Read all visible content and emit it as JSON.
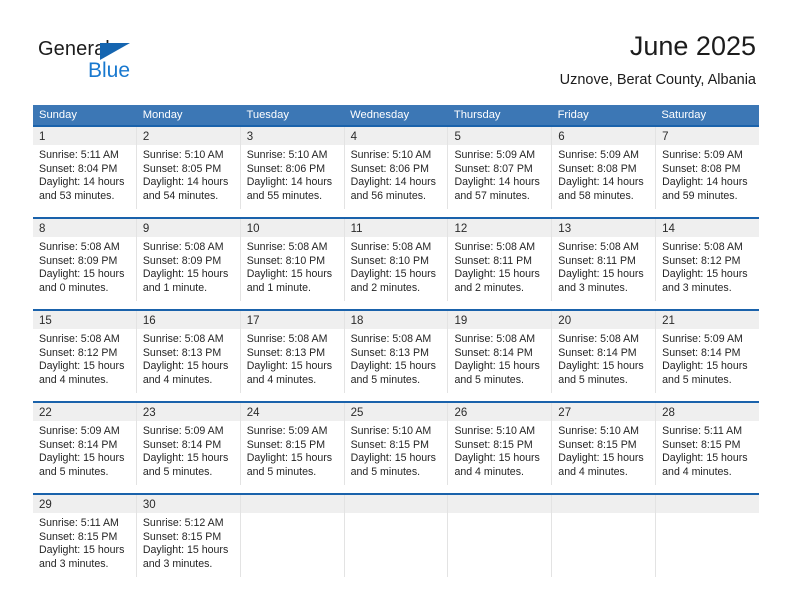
{
  "brand": {
    "name_part1": "General",
    "name_part2": "Blue",
    "accent_color": "#1878cf",
    "triangle_color": "#1565b0"
  },
  "header": {
    "title": "June 2025",
    "subtitle": "Uznove, Berat County, Albania"
  },
  "theme": {
    "header_bg": "#3c77b5",
    "week_border": "#1a62ab",
    "daynum_band": "#efefef"
  },
  "weekdays": [
    "Sunday",
    "Monday",
    "Tuesday",
    "Wednesday",
    "Thursday",
    "Friday",
    "Saturday"
  ],
  "weeks": [
    [
      {
        "day": "1",
        "sunrise": "Sunrise: 5:11 AM",
        "sunset": "Sunset: 8:04 PM",
        "daylight1": "Daylight: 14 hours",
        "daylight2": "and 53 minutes."
      },
      {
        "day": "2",
        "sunrise": "Sunrise: 5:10 AM",
        "sunset": "Sunset: 8:05 PM",
        "daylight1": "Daylight: 14 hours",
        "daylight2": "and 54 minutes."
      },
      {
        "day": "3",
        "sunrise": "Sunrise: 5:10 AM",
        "sunset": "Sunset: 8:06 PM",
        "daylight1": "Daylight: 14 hours",
        "daylight2": "and 55 minutes."
      },
      {
        "day": "4",
        "sunrise": "Sunrise: 5:10 AM",
        "sunset": "Sunset: 8:06 PM",
        "daylight1": "Daylight: 14 hours",
        "daylight2": "and 56 minutes."
      },
      {
        "day": "5",
        "sunrise": "Sunrise: 5:09 AM",
        "sunset": "Sunset: 8:07 PM",
        "daylight1": "Daylight: 14 hours",
        "daylight2": "and 57 minutes."
      },
      {
        "day": "6",
        "sunrise": "Sunrise: 5:09 AM",
        "sunset": "Sunset: 8:08 PM",
        "daylight1": "Daylight: 14 hours",
        "daylight2": "and 58 minutes."
      },
      {
        "day": "7",
        "sunrise": "Sunrise: 5:09 AM",
        "sunset": "Sunset: 8:08 PM",
        "daylight1": "Daylight: 14 hours",
        "daylight2": "and 59 minutes."
      }
    ],
    [
      {
        "day": "8",
        "sunrise": "Sunrise: 5:08 AM",
        "sunset": "Sunset: 8:09 PM",
        "daylight1": "Daylight: 15 hours",
        "daylight2": "and 0 minutes."
      },
      {
        "day": "9",
        "sunrise": "Sunrise: 5:08 AM",
        "sunset": "Sunset: 8:09 PM",
        "daylight1": "Daylight: 15 hours",
        "daylight2": "and 1 minute."
      },
      {
        "day": "10",
        "sunrise": "Sunrise: 5:08 AM",
        "sunset": "Sunset: 8:10 PM",
        "daylight1": "Daylight: 15 hours",
        "daylight2": "and 1 minute."
      },
      {
        "day": "11",
        "sunrise": "Sunrise: 5:08 AM",
        "sunset": "Sunset: 8:10 PM",
        "daylight1": "Daylight: 15 hours",
        "daylight2": "and 2 minutes."
      },
      {
        "day": "12",
        "sunrise": "Sunrise: 5:08 AM",
        "sunset": "Sunset: 8:11 PM",
        "daylight1": "Daylight: 15 hours",
        "daylight2": "and 2 minutes."
      },
      {
        "day": "13",
        "sunrise": "Sunrise: 5:08 AM",
        "sunset": "Sunset: 8:11 PM",
        "daylight1": "Daylight: 15 hours",
        "daylight2": "and 3 minutes."
      },
      {
        "day": "14",
        "sunrise": "Sunrise: 5:08 AM",
        "sunset": "Sunset: 8:12 PM",
        "daylight1": "Daylight: 15 hours",
        "daylight2": "and 3 minutes."
      }
    ],
    [
      {
        "day": "15",
        "sunrise": "Sunrise: 5:08 AM",
        "sunset": "Sunset: 8:12 PM",
        "daylight1": "Daylight: 15 hours",
        "daylight2": "and 4 minutes."
      },
      {
        "day": "16",
        "sunrise": "Sunrise: 5:08 AM",
        "sunset": "Sunset: 8:13 PM",
        "daylight1": "Daylight: 15 hours",
        "daylight2": "and 4 minutes."
      },
      {
        "day": "17",
        "sunrise": "Sunrise: 5:08 AM",
        "sunset": "Sunset: 8:13 PM",
        "daylight1": "Daylight: 15 hours",
        "daylight2": "and 4 minutes."
      },
      {
        "day": "18",
        "sunrise": "Sunrise: 5:08 AM",
        "sunset": "Sunset: 8:13 PM",
        "daylight1": "Daylight: 15 hours",
        "daylight2": "and 5 minutes."
      },
      {
        "day": "19",
        "sunrise": "Sunrise: 5:08 AM",
        "sunset": "Sunset: 8:14 PM",
        "daylight1": "Daylight: 15 hours",
        "daylight2": "and 5 minutes."
      },
      {
        "day": "20",
        "sunrise": "Sunrise: 5:08 AM",
        "sunset": "Sunset: 8:14 PM",
        "daylight1": "Daylight: 15 hours",
        "daylight2": "and 5 minutes."
      },
      {
        "day": "21",
        "sunrise": "Sunrise: 5:09 AM",
        "sunset": "Sunset: 8:14 PM",
        "daylight1": "Daylight: 15 hours",
        "daylight2": "and 5 minutes."
      }
    ],
    [
      {
        "day": "22",
        "sunrise": "Sunrise: 5:09 AM",
        "sunset": "Sunset: 8:14 PM",
        "daylight1": "Daylight: 15 hours",
        "daylight2": "and 5 minutes."
      },
      {
        "day": "23",
        "sunrise": "Sunrise: 5:09 AM",
        "sunset": "Sunset: 8:14 PM",
        "daylight1": "Daylight: 15 hours",
        "daylight2": "and 5 minutes."
      },
      {
        "day": "24",
        "sunrise": "Sunrise: 5:09 AM",
        "sunset": "Sunset: 8:15 PM",
        "daylight1": "Daylight: 15 hours",
        "daylight2": "and 5 minutes."
      },
      {
        "day": "25",
        "sunrise": "Sunrise: 5:10 AM",
        "sunset": "Sunset: 8:15 PM",
        "daylight1": "Daylight: 15 hours",
        "daylight2": "and 5 minutes."
      },
      {
        "day": "26",
        "sunrise": "Sunrise: 5:10 AM",
        "sunset": "Sunset: 8:15 PM",
        "daylight1": "Daylight: 15 hours",
        "daylight2": "and 4 minutes."
      },
      {
        "day": "27",
        "sunrise": "Sunrise: 5:10 AM",
        "sunset": "Sunset: 8:15 PM",
        "daylight1": "Daylight: 15 hours",
        "daylight2": "and 4 minutes."
      },
      {
        "day": "28",
        "sunrise": "Sunrise: 5:11 AM",
        "sunset": "Sunset: 8:15 PM",
        "daylight1": "Daylight: 15 hours",
        "daylight2": "and 4 minutes."
      }
    ],
    [
      {
        "day": "29",
        "sunrise": "Sunrise: 5:11 AM",
        "sunset": "Sunset: 8:15 PM",
        "daylight1": "Daylight: 15 hours",
        "daylight2": "and 3 minutes."
      },
      {
        "day": "30",
        "sunrise": "Sunrise: 5:12 AM",
        "sunset": "Sunset: 8:15 PM",
        "daylight1": "Daylight: 15 hours",
        "daylight2": "and 3 minutes."
      },
      {
        "day": "",
        "sunrise": "",
        "sunset": "",
        "daylight1": "",
        "daylight2": ""
      },
      {
        "day": "",
        "sunrise": "",
        "sunset": "",
        "daylight1": "",
        "daylight2": ""
      },
      {
        "day": "",
        "sunrise": "",
        "sunset": "",
        "daylight1": "",
        "daylight2": ""
      },
      {
        "day": "",
        "sunrise": "",
        "sunset": "",
        "daylight1": "",
        "daylight2": ""
      },
      {
        "day": "",
        "sunrise": "",
        "sunset": "",
        "daylight1": "",
        "daylight2": ""
      }
    ]
  ]
}
